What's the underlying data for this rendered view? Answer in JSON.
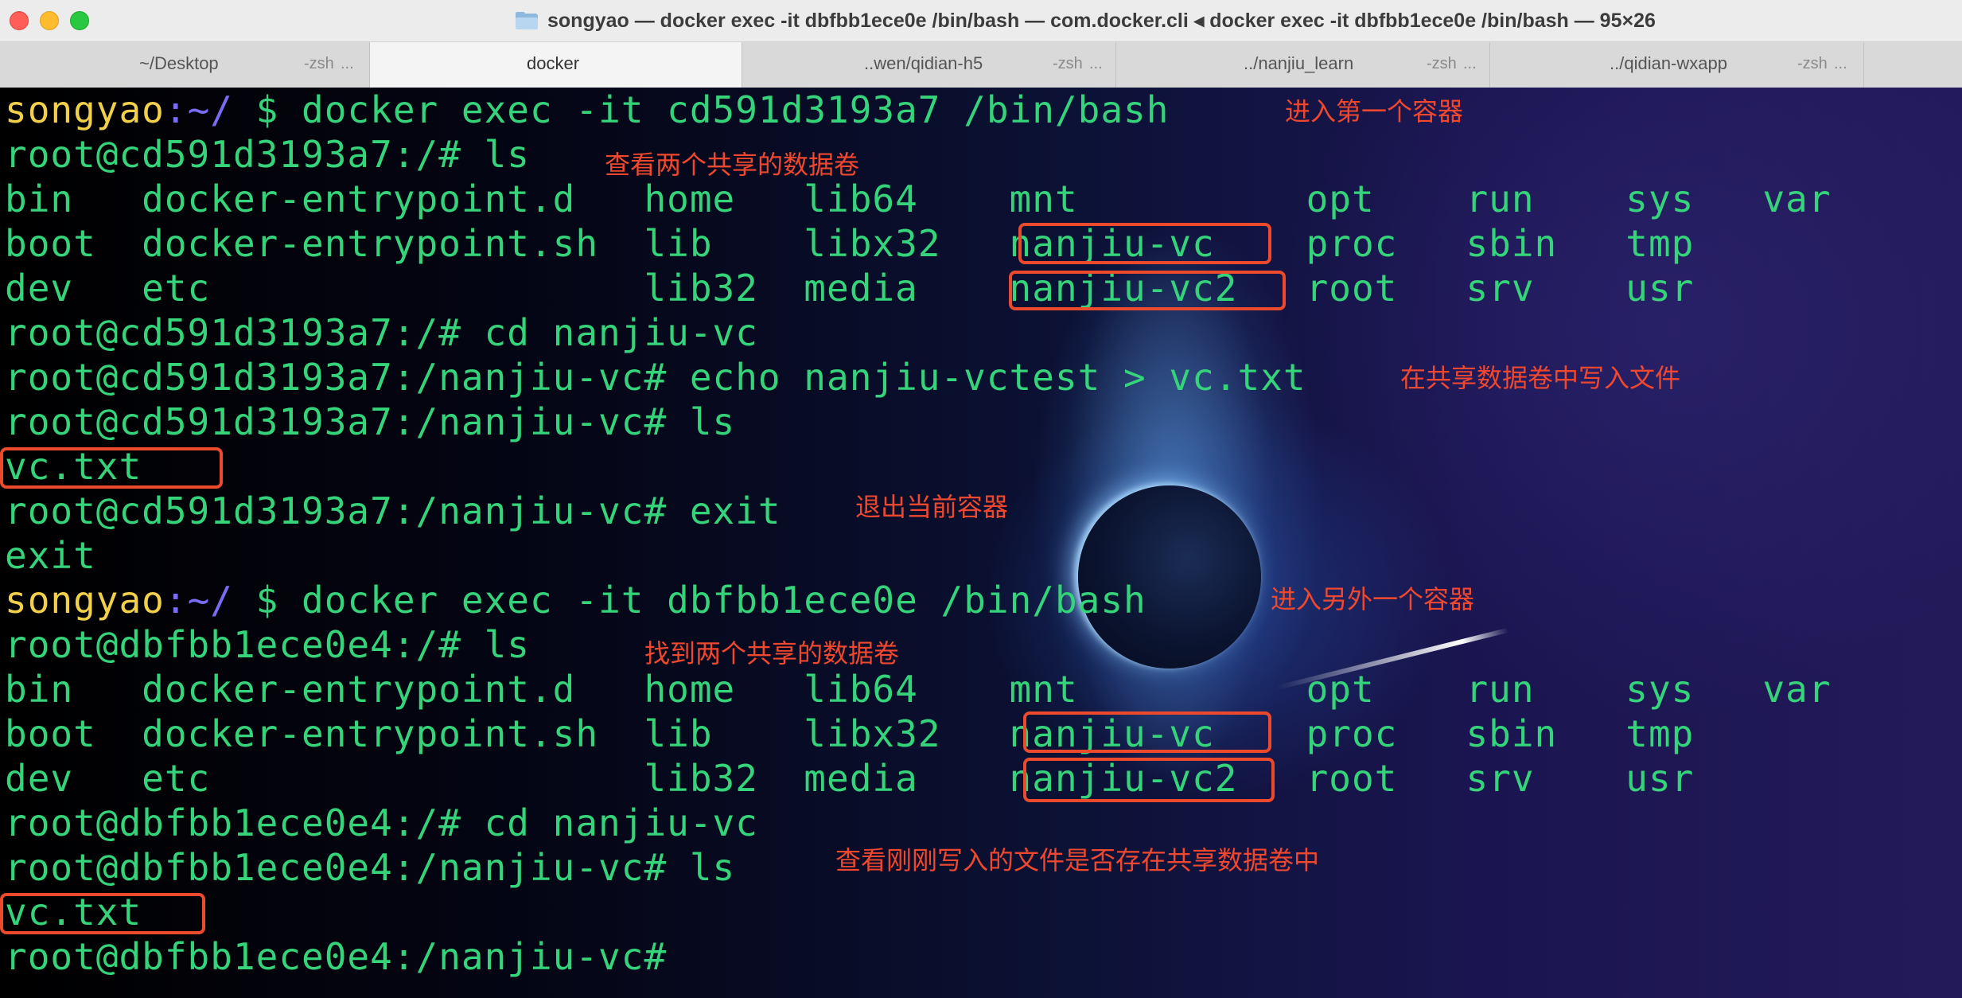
{
  "window": {
    "title": "songyao — docker exec -it dbfbb1ece0e /bin/bash — com.docker.cli ◂ docker exec -it dbfbb1ece0e /bin/bash — 95×26"
  },
  "tabs": [
    {
      "title": "~/Desktop",
      "sub": "-zsh",
      "more": "..."
    },
    {
      "title": "docker",
      "sub": "",
      "more": ""
    },
    {
      "title": "..wen/qidian-h5",
      "sub": "-zsh",
      "more": "..."
    },
    {
      "title": "../nanjiu_learn",
      "sub": "-zsh",
      "more": "..."
    },
    {
      "title": "../qidian-wxapp",
      "sub": "-zsh",
      "more": "..."
    }
  ],
  "terminal": {
    "lines": [
      {
        "user": "songyao",
        "path": ":~/",
        "rest": " $ docker exec -it cd591d3193a7 /bin/bash"
      },
      {
        "text": "root@cd591d3193a7:/# ls"
      },
      {
        "text": "bin   docker-entrypoint.d   home   lib64    mnt          opt    run    sys   var"
      },
      {
        "text": "boot  docker-entrypoint.sh  lib    libx32   nanjiu-vc    proc   sbin   tmp"
      },
      {
        "text": "dev   etc                   lib32  media    nanjiu-vc2   root   srv    usr"
      },
      {
        "text": "root@cd591d3193a7:/# cd nanjiu-vc"
      },
      {
        "text": "root@cd591d3193a7:/nanjiu-vc# echo nanjiu-vctest > vc.txt"
      },
      {
        "text": "root@cd591d3193a7:/nanjiu-vc# ls"
      },
      {
        "text": "vc.txt"
      },
      {
        "text": "root@cd591d3193a7:/nanjiu-vc# exit"
      },
      {
        "text": "exit"
      },
      {
        "user": "songyao",
        "path": ":~/",
        "rest": " $ docker exec -it dbfbb1ece0e /bin/bash"
      },
      {
        "text": "root@dbfbb1ece0e4:/# ls"
      },
      {
        "text": "bin   docker-entrypoint.d   home   lib64    mnt          opt    run    sys   var"
      },
      {
        "text": "boot  docker-entrypoint.sh  lib    libx32   nanjiu-vc    proc   sbin   tmp"
      },
      {
        "text": "dev   etc                   lib32  media    nanjiu-vc2   root   srv    usr"
      },
      {
        "text": "root@dbfbb1ece0e4:/# cd nanjiu-vc"
      },
      {
        "text": "root@dbfbb1ece0e4:/nanjiu-vc# ls"
      },
      {
        "text": "vc.txt"
      },
      {
        "text": "root@dbfbb1ece0e4:/nanjiu-vc# "
      }
    ],
    "annotations": [
      "进入第一个容器",
      "查看两个共享的数据卷",
      "在共享数据卷中写入文件",
      "退出当前容器",
      "进入另外一个容器",
      "找到两个共享的数据卷",
      "查看刚刚写入的文件是否存在共享数据卷中"
    ]
  },
  "colors": {
    "prompt_user": "#f2d04a",
    "prompt_path": "#7b6cf6",
    "terminal_text": "#35d47a",
    "annotation": "#f0482e"
  }
}
